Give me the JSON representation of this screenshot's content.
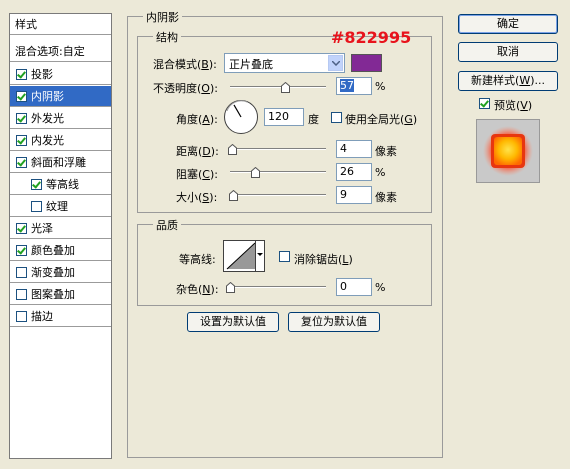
{
  "style_list": {
    "header": "样式",
    "blend_options": "混合选项:自定",
    "items": [
      {
        "label": "投影",
        "checked": true,
        "selected": false,
        "indent": false
      },
      {
        "label": "内阴影",
        "checked": true,
        "selected": true,
        "indent": false
      },
      {
        "label": "外发光",
        "checked": true,
        "selected": false,
        "indent": false
      },
      {
        "label": "内发光",
        "checked": true,
        "selected": false,
        "indent": false
      },
      {
        "label": "斜面和浮雕",
        "checked": true,
        "selected": false,
        "indent": false
      },
      {
        "label": "等高线",
        "checked": true,
        "selected": false,
        "indent": true
      },
      {
        "label": "纹理",
        "checked": false,
        "selected": false,
        "indent": true
      },
      {
        "label": "光泽",
        "checked": true,
        "selected": false,
        "indent": false
      },
      {
        "label": "颜色叠加",
        "checked": true,
        "selected": false,
        "indent": false
      },
      {
        "label": "渐变叠加",
        "checked": false,
        "selected": false,
        "indent": false
      },
      {
        "label": "图案叠加",
        "checked": false,
        "selected": false,
        "indent": false
      },
      {
        "label": "描边",
        "checked": false,
        "selected": false,
        "indent": false
      }
    ]
  },
  "panel": {
    "title": "内阴影",
    "structure": {
      "title": "结构",
      "blend_mode_label": "混合模式(",
      "blend_mode_key": "B",
      "blend_mode_value": "正片叠底",
      "color_swatch": "#822995",
      "color_annotation": "#822995",
      "opacity_label": "不透明度(",
      "opacity_key": "O",
      "opacity_value": "57",
      "opacity_unit": "%",
      "angle_label": "角度(",
      "angle_key": "A",
      "angle_value": "120",
      "angle_unit": "度",
      "global_light_label": "使用全局光(",
      "global_light_key": "G",
      "global_light_checked": false,
      "distance_label": "距离(",
      "distance_key": "D",
      "distance_value": "4",
      "distance_unit": "像素",
      "choke_label": "阻塞(",
      "choke_key": "C",
      "choke_value": "26",
      "choke_unit": "%",
      "size_label": "大小(",
      "size_key": "S",
      "size_value": "9",
      "size_unit": "像素"
    },
    "quality": {
      "title": "品质",
      "contour_label": "等高线:",
      "antialias_label": "消除锯齿(",
      "antialias_key": "L",
      "antialias_checked": false,
      "noise_label": "杂色(",
      "noise_key": "N",
      "noise_value": "0",
      "noise_unit": "%"
    },
    "make_default": "设置为默认值",
    "reset_default": "复位为默认值"
  },
  "buttons": {
    "ok": "确定",
    "cancel": "取消",
    "new_style": "新建样式(",
    "new_style_key": "W",
    "new_style_suffix": ")...",
    "preview_label": "预览(",
    "preview_key": "V",
    "preview_checked": true
  },
  "icons": [
    "checkbox-icon",
    "dropdown-arrow-icon",
    "angle-dial-icon",
    "slider-thumb-icon",
    "contour-curve-icon",
    "style-preview-icon"
  ]
}
